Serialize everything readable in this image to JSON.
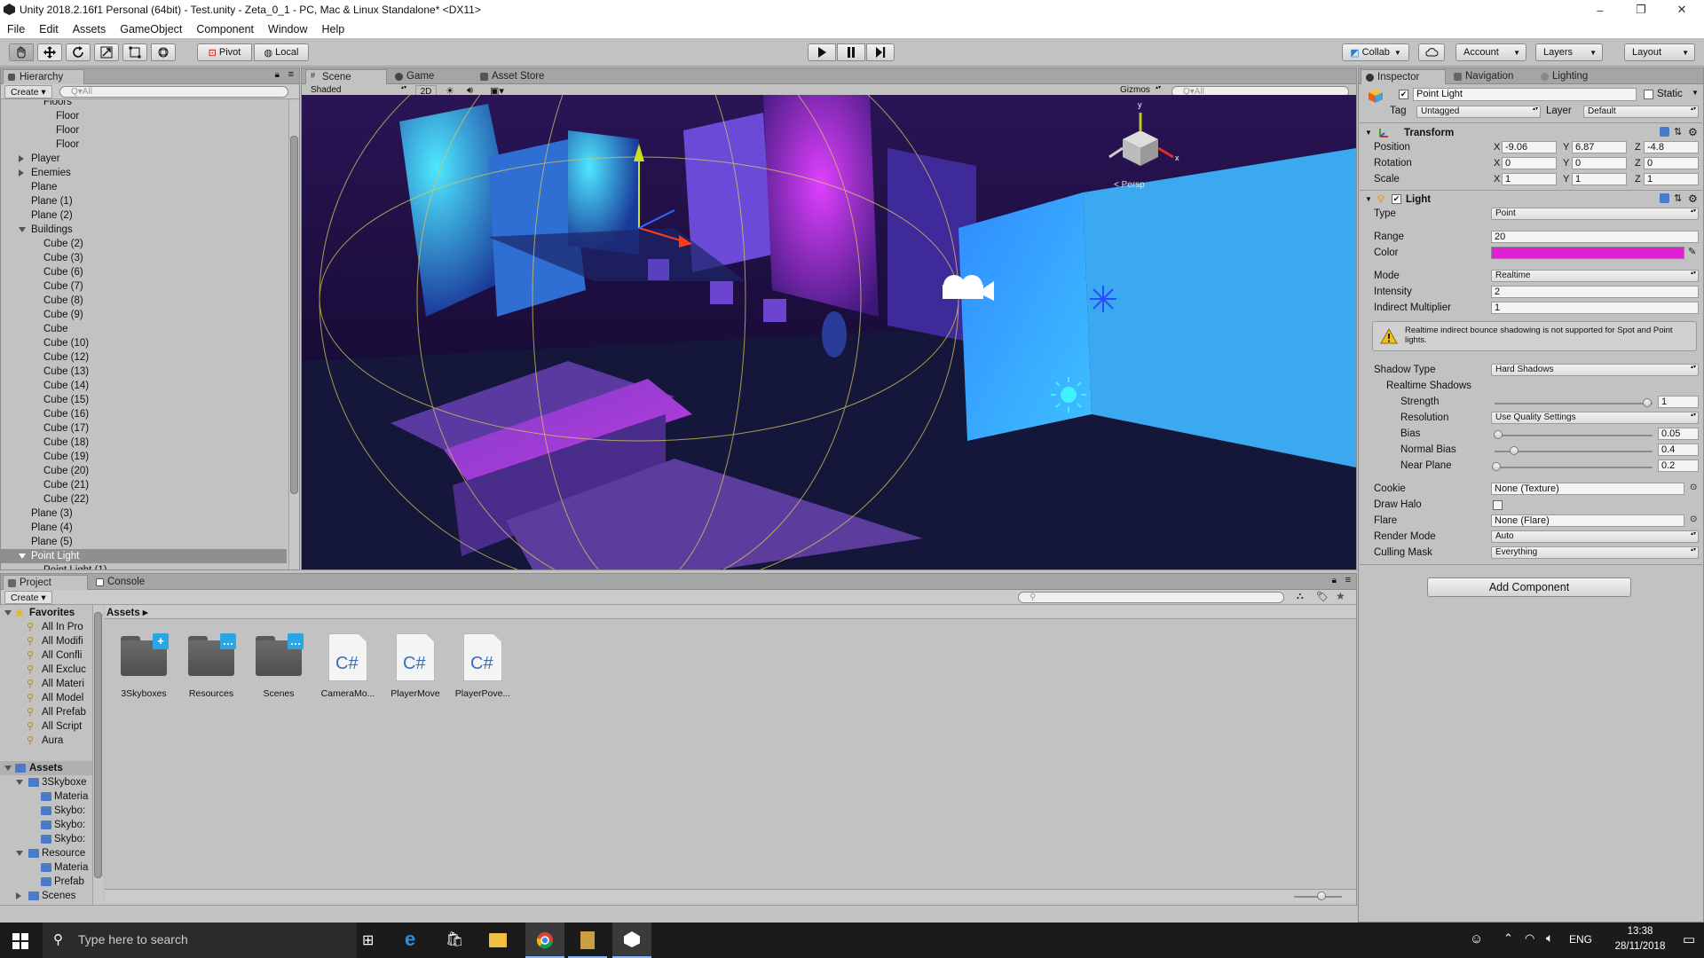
{
  "window": {
    "title": "Unity 2018.2.16f1 Personal (64bit) - Test.unity - Zeta_0_1 - PC, Mac & Linux Standalone* <DX11>",
    "min": "–",
    "max": "❐",
    "close": "✕"
  },
  "menu": [
    "File",
    "Edit",
    "Assets",
    "GameObject",
    "Component",
    "Window",
    "Help"
  ],
  "toolbar": {
    "pivot": "Pivot",
    "local": "Local",
    "collab": "Collab",
    "account": "Account",
    "layers": "Layers",
    "layout": "Layout",
    "tools": [
      "hand-tool-icon",
      "move-tool-icon",
      "rotate-tool-icon",
      "scale-tool-icon",
      "rect-tool-icon",
      "transform-tool-icon"
    ]
  },
  "hierarchy": {
    "tab": "Hierarchy",
    "create": "Create",
    "search_placeholder": "Q▾All",
    "rows": [
      {
        "label": "Floors",
        "indent": 3
      },
      {
        "label": "Floor",
        "indent": 4
      },
      {
        "label": "Floor",
        "indent": 4
      },
      {
        "label": "Floor",
        "indent": 4
      },
      {
        "label": "Player",
        "indent": 2,
        "arrow": "right"
      },
      {
        "label": "Enemies",
        "indent": 2,
        "arrow": "right"
      },
      {
        "label": "Plane",
        "indent": 2
      },
      {
        "label": "Plane (1)",
        "indent": 2
      },
      {
        "label": "Plane (2)",
        "indent": 2
      },
      {
        "label": "Buildings",
        "indent": 2,
        "arrow": "down"
      },
      {
        "label": "Cube (2)",
        "indent": 3
      },
      {
        "label": "Cube (3)",
        "indent": 3
      },
      {
        "label": "Cube (6)",
        "indent": 3
      },
      {
        "label": "Cube (7)",
        "indent": 3
      },
      {
        "label": "Cube (8)",
        "indent": 3
      },
      {
        "label": "Cube (9)",
        "indent": 3
      },
      {
        "label": "Cube",
        "indent": 3
      },
      {
        "label": "Cube (10)",
        "indent": 3
      },
      {
        "label": "Cube (12)",
        "indent": 3
      },
      {
        "label": "Cube (13)",
        "indent": 3
      },
      {
        "label": "Cube (14)",
        "indent": 3
      },
      {
        "label": "Cube (15)",
        "indent": 3
      },
      {
        "label": "Cube (16)",
        "indent": 3
      },
      {
        "label": "Cube (17)",
        "indent": 3
      },
      {
        "label": "Cube (18)",
        "indent": 3
      },
      {
        "label": "Cube (19)",
        "indent": 3
      },
      {
        "label": "Cube (20)",
        "indent": 3
      },
      {
        "label": "Cube (21)",
        "indent": 3
      },
      {
        "label": "Cube (22)",
        "indent": 3
      },
      {
        "label": "Plane (3)",
        "indent": 2
      },
      {
        "label": "Plane (4)",
        "indent": 2
      },
      {
        "label": "Plane (5)",
        "indent": 2
      },
      {
        "label": "Point Light",
        "indent": 2,
        "arrow": "down",
        "selected": true
      },
      {
        "label": "Point Light (1)",
        "indent": 3
      }
    ]
  },
  "scene": {
    "tabs": [
      "Scene",
      "Game",
      "Asset Store"
    ],
    "shaded": "Shaded",
    "twod": "2D",
    "gizmos": "Gizmos",
    "search_placeholder": "Q▾All",
    "persp": "< Persp"
  },
  "project": {
    "tabs": [
      "Project",
      "Console"
    ],
    "create": "Create",
    "favorites_header": "Favorites",
    "favorites": [
      "All In Pro",
      "All Modifi",
      "All Confli",
      "All Excluc",
      "All Materi",
      "All Model",
      "All Prefab",
      "All Script",
      "Aura"
    ],
    "assets_header": "Assets",
    "tree": [
      {
        "label": "3Skyboxe",
        "indent": 1,
        "arrow": "down"
      },
      {
        "label": "Materia",
        "indent": 2
      },
      {
        "label": "Skybo:",
        "indent": 2
      },
      {
        "label": "Skybo:",
        "indent": 2
      },
      {
        "label": "Skybo:",
        "indent": 2
      },
      {
        "label": "Resource",
        "indent": 1,
        "arrow": "down"
      },
      {
        "label": "Materia",
        "indent": 2
      },
      {
        "label": "Prefab",
        "indent": 2
      },
      {
        "label": "Scenes",
        "indent": 1,
        "arrow": "right"
      }
    ],
    "breadcrumb": "Assets ▸",
    "items": [
      {
        "label": "3Skyboxes",
        "kind": "folder",
        "badge": "+"
      },
      {
        "label": "Resources",
        "kind": "folder",
        "badge": "…"
      },
      {
        "label": "Scenes",
        "kind": "folder",
        "badge": "…"
      },
      {
        "label": "CameraMo...",
        "kind": "script",
        "glyph": "C#"
      },
      {
        "label": "PlayerMove",
        "kind": "script",
        "glyph": "C#"
      },
      {
        "label": "PlayerPove...",
        "kind": "script",
        "glyph": "C#"
      }
    ]
  },
  "inspector": {
    "tabs": [
      "Inspector",
      "Navigation",
      "Lighting"
    ],
    "object_name": "Point Light",
    "static": "Static",
    "tag_label": "Tag",
    "tag": "Untagged",
    "layer_label": "Layer",
    "layer": "Default",
    "transform": {
      "title": "Transform",
      "position_label": "Position",
      "position": {
        "x": "-9.06",
        "y": "6.87",
        "z": "-4.8"
      },
      "rotation_label": "Rotation",
      "rotation": {
        "x": "0",
        "y": "0",
        "z": "0"
      },
      "scale_label": "Scale",
      "scale": {
        "x": "1",
        "y": "1",
        "z": "1"
      },
      "x": "X",
      "y": "Y",
      "z": "Z"
    },
    "light": {
      "title": "Light",
      "type_label": "Type",
      "type": "Point",
      "range_label": "Range",
      "range": "20",
      "color_label": "Color",
      "color": "#e01ed2",
      "mode_label": "Mode",
      "mode": "Realtime",
      "intensity_label": "Intensity",
      "intensity": "2",
      "indirect_label": "Indirect Multiplier",
      "indirect": "1",
      "warning": "Realtime indirect bounce shadowing is not supported for Spot and Point lights.",
      "shadow_type_label": "Shadow Type",
      "shadow_type": "Hard Shadows",
      "realtime_shadows_label": "Realtime Shadows",
      "strength_label": "Strength",
      "strength": "1",
      "strength_frac": 1.0,
      "resolution_label": "Resolution",
      "resolution": "Use Quality Settings",
      "bias_label": "Bias",
      "bias": "0.05",
      "bias_frac": 0.025,
      "normal_bias_label": "Normal Bias",
      "normal_bias": "0.4",
      "normal_bias_frac": 0.13,
      "near_plane_label": "Near Plane",
      "near_plane": "0.2",
      "near_plane_frac": 0.01,
      "cookie_label": "Cookie",
      "cookie": "None (Texture)",
      "draw_halo_label": "Draw Halo",
      "flare_label": "Flare",
      "flare": "None (Flare)",
      "render_mode_label": "Render Mode",
      "render_mode": "Auto",
      "culling_mask_label": "Culling Mask",
      "culling_mask": "Everything"
    },
    "add_component": "Add Component"
  },
  "taskbar": {
    "search_placeholder": "Type here to search",
    "lang": "ENG",
    "time": "13:38",
    "date": "28/11/2018"
  }
}
